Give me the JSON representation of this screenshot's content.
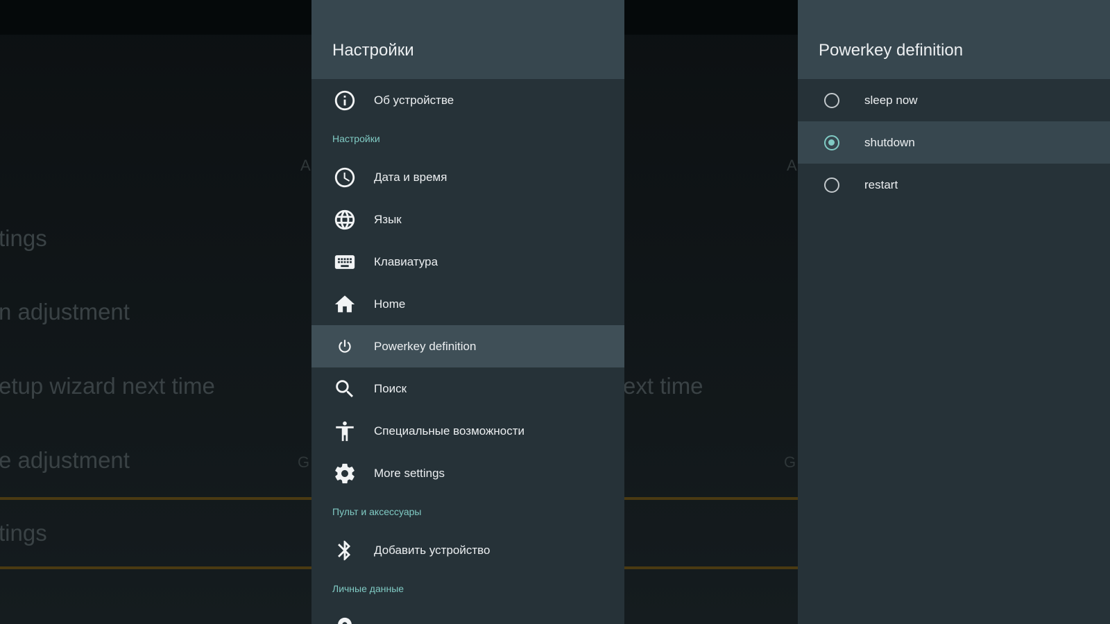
{
  "background_app": {
    "lines": [
      "tings",
      "n adjustment",
      "etup wizard next time",
      "e adjustment",
      "tings"
    ],
    "mid_fragment": "ext time"
  },
  "settings": {
    "title": "Настройки",
    "about_label": "Об устройстве",
    "section_settings": "Настройки",
    "items": [
      {
        "icon": "clock-icon",
        "label": "Дата и время"
      },
      {
        "icon": "globe-icon",
        "label": "Язык"
      },
      {
        "icon": "keyboard-icon",
        "label": "Клавиатура"
      },
      {
        "icon": "home-icon",
        "label": "Home"
      },
      {
        "icon": "power-icon",
        "label": "Powerkey definition",
        "selected": true
      },
      {
        "icon": "search-icon",
        "label": "Поиск"
      },
      {
        "icon": "accessibility-icon",
        "label": "Специальные возможности"
      },
      {
        "icon": "gear-icon",
        "label": "More settings"
      }
    ],
    "section_remote": "Пульт и аксессуары",
    "add_device_label": "Добавить устройство",
    "section_personal": "Личные данные"
  },
  "powerkey": {
    "title": "Powerkey definition",
    "options": [
      {
        "label": "sleep now",
        "checked": false
      },
      {
        "label": "shutdown",
        "checked": true
      },
      {
        "label": "restart",
        "checked": false
      }
    ]
  },
  "colors": {
    "panel": "#263238",
    "header": "#37474f",
    "accent": "#80cbc4",
    "text": "#eceff1"
  }
}
